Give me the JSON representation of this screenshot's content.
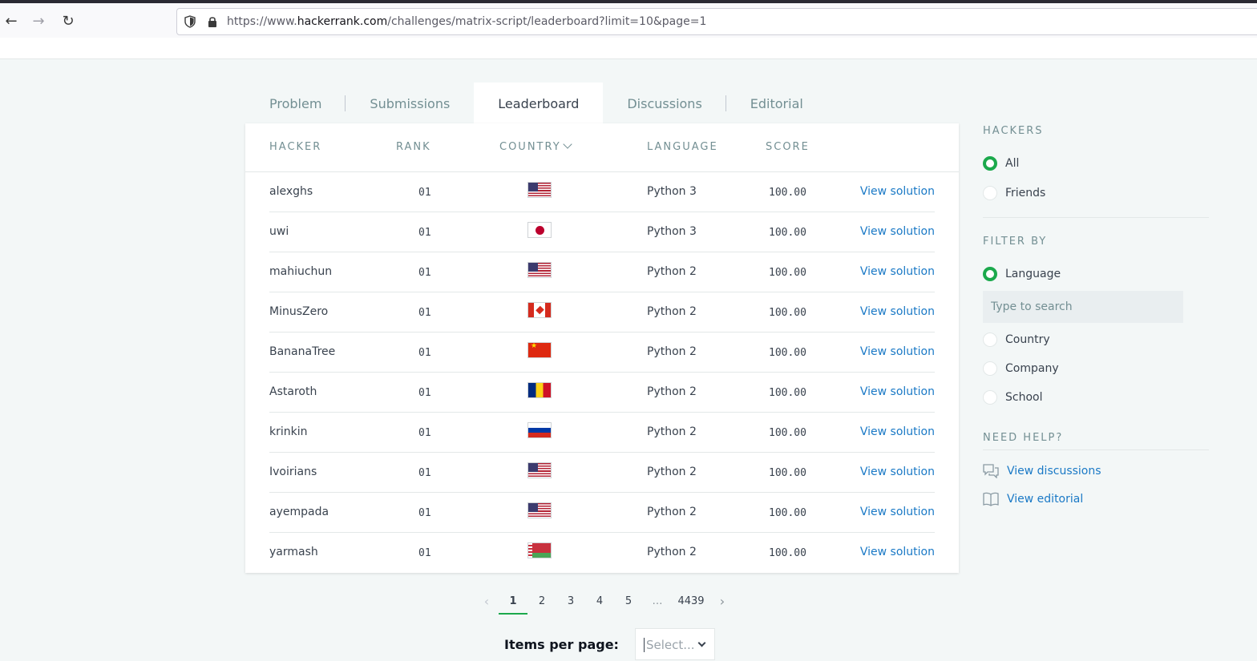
{
  "browser": {
    "url_prefix": "https://www.",
    "url_domain": "hackerrank.com",
    "url_path": "/challenges/matrix-script/leaderboard?limit=10&page=1"
  },
  "tabs": [
    {
      "label": "Problem"
    },
    {
      "label": "Submissions"
    },
    {
      "label": "Leaderboard"
    },
    {
      "label": "Discussions"
    },
    {
      "label": "Editorial"
    }
  ],
  "table": {
    "headers": {
      "hacker": "HACKER",
      "rank": "RANK",
      "country": "COUNTRY",
      "language": "LANGUAGE",
      "score": "SCORE"
    },
    "rows": [
      {
        "hacker": "alexghs",
        "rank": "01",
        "country_flag": "us",
        "language": "Python 3",
        "score": "100.00",
        "action": "View solution"
      },
      {
        "hacker": "uwi",
        "rank": "01",
        "country_flag": "jp",
        "language": "Python 3",
        "score": "100.00",
        "action": "View solution"
      },
      {
        "hacker": "mahiuchun",
        "rank": "01",
        "country_flag": "us",
        "language": "Python 2",
        "score": "100.00",
        "action": "View solution"
      },
      {
        "hacker": "MinusZero",
        "rank": "01",
        "country_flag": "ca",
        "language": "Python 2",
        "score": "100.00",
        "action": "View solution"
      },
      {
        "hacker": "BananaTree",
        "rank": "01",
        "country_flag": "cn",
        "language": "Python 2",
        "score": "100.00",
        "action": "View solution"
      },
      {
        "hacker": "Astaroth",
        "rank": "01",
        "country_flag": "ro",
        "language": "Python 2",
        "score": "100.00",
        "action": "View solution"
      },
      {
        "hacker": "krinkin",
        "rank": "01",
        "country_flag": "ru",
        "language": "Python 2",
        "score": "100.00",
        "action": "View solution"
      },
      {
        "hacker": "Ivoirians",
        "rank": "01",
        "country_flag": "us",
        "language": "Python 2",
        "score": "100.00",
        "action": "View solution"
      },
      {
        "hacker": "ayempada",
        "rank": "01",
        "country_flag": "us",
        "language": "Python 2",
        "score": "100.00",
        "action": "View solution"
      },
      {
        "hacker": "yarmash",
        "rank": "01",
        "country_flag": "by",
        "language": "Python 2",
        "score": "100.00",
        "action": "View solution"
      }
    ]
  },
  "pagination": {
    "pages": [
      "1",
      "2",
      "3",
      "4",
      "5"
    ],
    "ellipsis": "…",
    "last": "4439",
    "current": "1",
    "prev_icon": "‹",
    "next_icon": "›"
  },
  "items_per_page": {
    "label": "Items per page:",
    "placeholder": "Select..."
  },
  "sidebar": {
    "hackers_heading": "HACKERS",
    "hackers_options": [
      {
        "label": "All",
        "checked": true
      },
      {
        "label": "Friends",
        "checked": false
      }
    ],
    "filter_heading": "FILTER BY",
    "filter_options": [
      {
        "label": "Language",
        "checked": true
      },
      {
        "label": "Country",
        "checked": false
      },
      {
        "label": "Company",
        "checked": false
      },
      {
        "label": "School",
        "checked": false
      }
    ],
    "search_placeholder": "Type to search",
    "help_heading": "NEED HELP?",
    "help_links": [
      {
        "label": "View discussions",
        "icon": "discussion-icon"
      },
      {
        "label": "View editorial",
        "icon": "book-icon"
      }
    ]
  },
  "colors": {
    "accent_green": "#1ba94c",
    "link_blue": "#1a79c6",
    "muted_text": "#738f93"
  }
}
